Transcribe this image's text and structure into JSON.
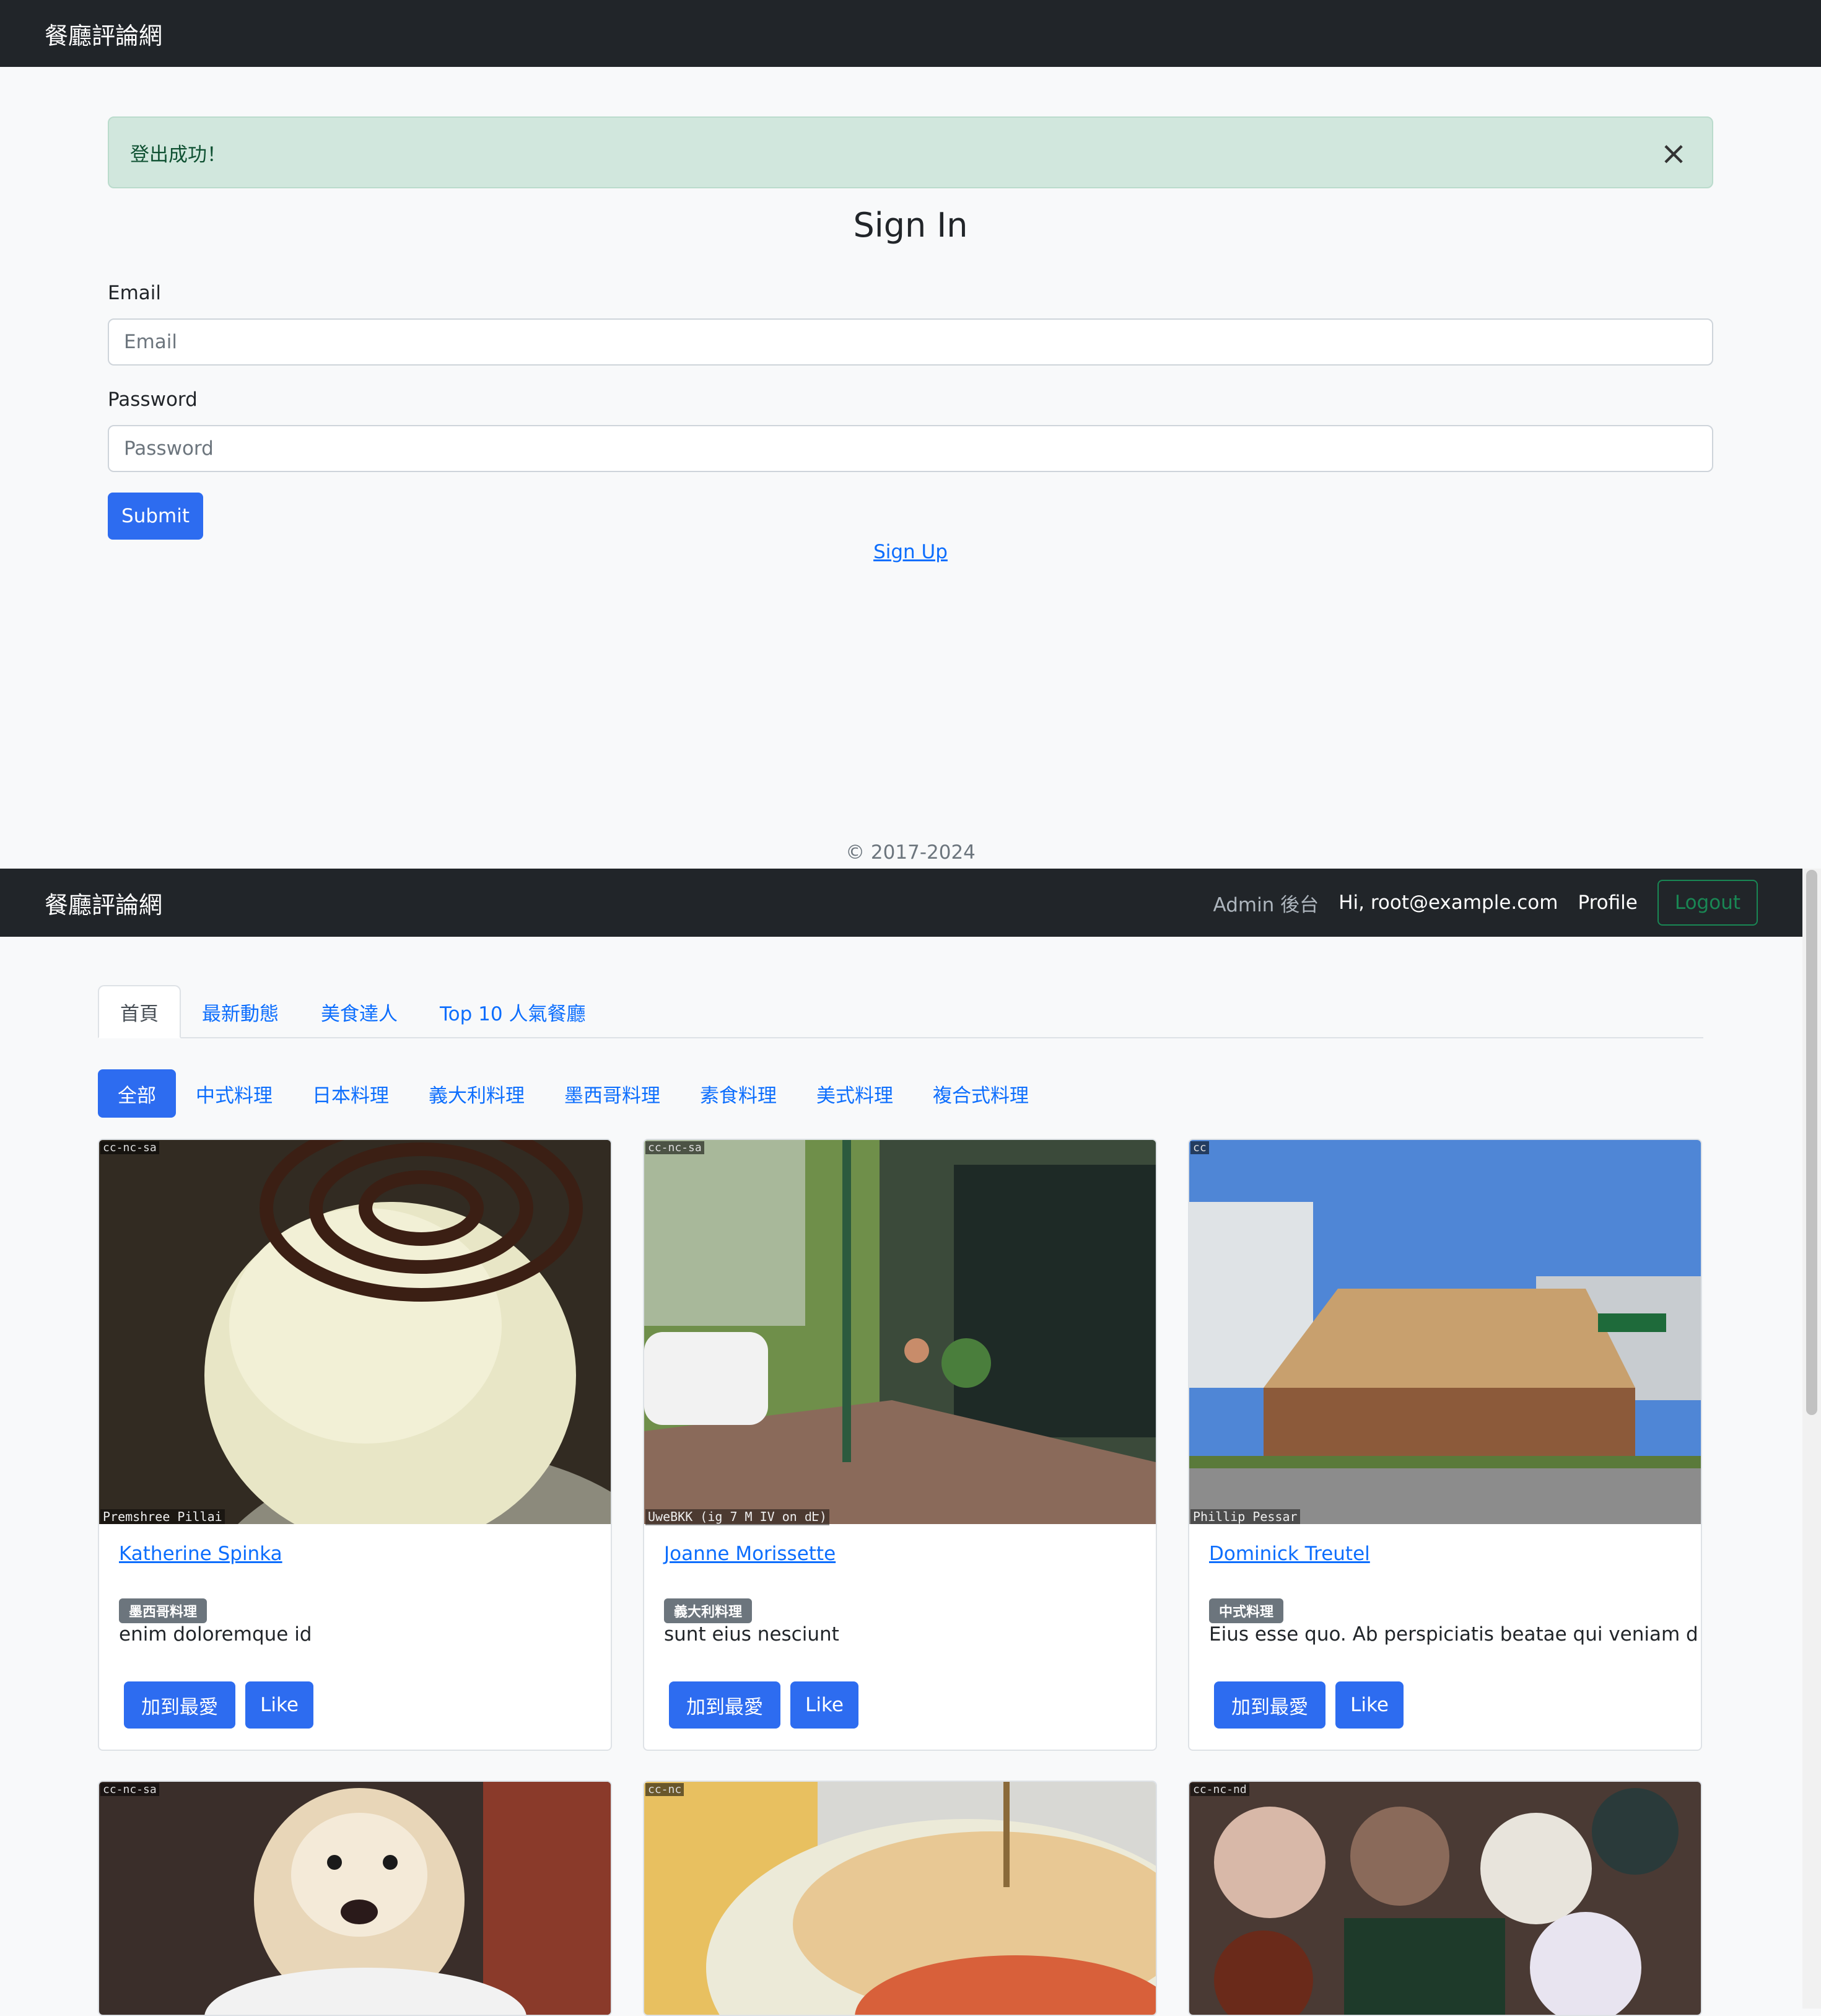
{
  "login_page": {
    "brand": "餐廳評論網",
    "alert": "登出成功！",
    "title": "Sign In",
    "email_label": "Email",
    "email_placeholder": "Email",
    "password_label": "Password",
    "password_placeholder": "Password",
    "submit_label": "Submit",
    "signup_label": "Sign Up",
    "copyright": "© 2017-2024"
  },
  "home_page": {
    "brand": "餐廳評論網",
    "nav": {
      "admin": "Admin 後台",
      "greeting": "Hi, root@example.com",
      "profile": "Profile",
      "logout": "Logout"
    },
    "tabs": [
      "首頁",
      "最新動態",
      "美食達人",
      "Top 10 人氣餐廳"
    ],
    "categories": [
      "全部",
      "中式料理",
      "日本料理",
      "義大利料理",
      "墨西哥料理",
      "素食料理",
      "美式料理",
      "複合式料理"
    ],
    "restaurants": [
      {
        "name": "Katherine Spinka",
        "category": "墨西哥料理",
        "description": "enim doloremque id",
        "license": "cc-nc-sa",
        "credit": "Premshree Pillai",
        "fav_label": "加到最愛",
        "like_label": "Like",
        "image": "ice-cream-dessert"
      },
      {
        "name": "Joanne Morissette",
        "category": "義大利料理",
        "description": "sunt eius nesciunt",
        "license": "cc-nc-sa",
        "credit": "UweBKK (ig 7 M IV on ԁԷ)",
        "fav_label": "加到最愛",
        "like_label": "Like",
        "image": "street-cafe"
      },
      {
        "name": "Dominick Treutel",
        "category": "中式料理",
        "description": "Eius esse quo. Ab perspiciatis beatae qui veniam d",
        "license": "cc",
        "credit": "Phillip Pessar",
        "fav_label": "加到最愛",
        "like_label": "Like",
        "image": "subway-restaurant"
      }
    ],
    "restaurants_row2": [
      {
        "license": "cc-nc-sa",
        "image": "dog-at-table"
      },
      {
        "license": "cc-nc",
        "image": "burger-and-fries"
      },
      {
        "license": "cc-nc-nd",
        "image": "japanese-dishes"
      }
    ]
  }
}
